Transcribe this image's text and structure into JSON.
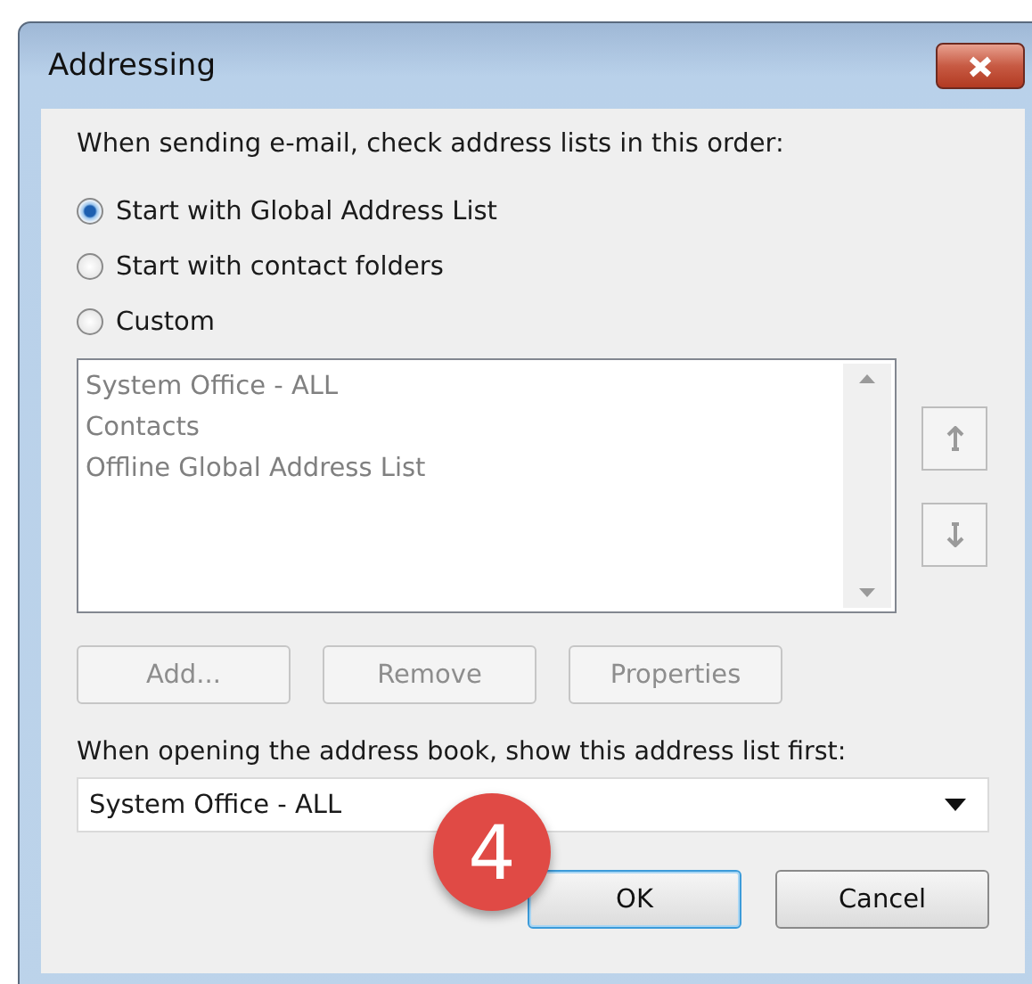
{
  "window": {
    "title": "Addressing"
  },
  "prompt": "When sending e-mail, check address lists in this order:",
  "options": [
    {
      "label": "Start with Global Address List",
      "selected": true
    },
    {
      "label": "Start with contact folders",
      "selected": false
    },
    {
      "label": "Custom",
      "selected": false
    }
  ],
  "address_lists": {
    "disabled": true,
    "items": [
      "System Office - ALL",
      "Contacts",
      "Offline Global Address List"
    ]
  },
  "list_buttons": [
    {
      "label": "Add...",
      "disabled": true
    },
    {
      "label": "Remove",
      "disabled": true
    },
    {
      "label": "Properties",
      "disabled": true
    }
  ],
  "first_list": {
    "label": "When opening the address book, show this address list first:",
    "value": "System Office - ALL"
  },
  "step_badge": "4",
  "buttons": [
    {
      "label": "OK",
      "default": true
    },
    {
      "label": "Cancel",
      "default": false
    }
  ]
}
